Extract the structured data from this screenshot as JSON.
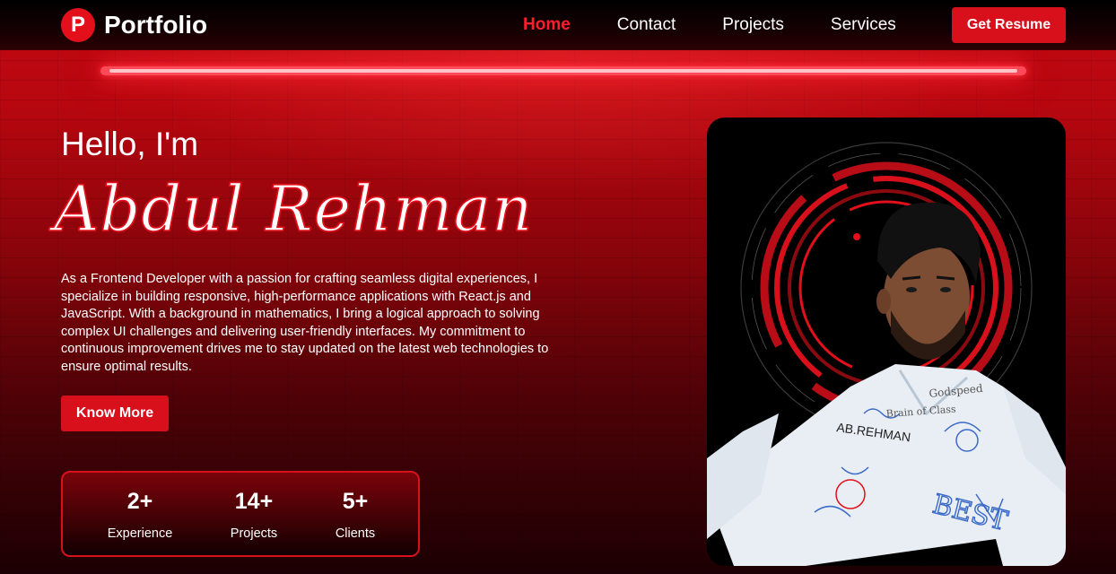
{
  "brand": {
    "logo_letter": "P",
    "name": "Portfolio"
  },
  "nav": {
    "links": [
      "Home",
      "Contact",
      "Projects",
      "Services"
    ],
    "active": "Home",
    "resume_label": "Get Resume"
  },
  "hero": {
    "greeting": "Hello, I'm",
    "name": "Abdul Rehman",
    "bio": "As a Frontend Developer with a passion for crafting seamless digital experiences, I specialize in building responsive, high-performance applications with React.js and JavaScript. With a background in mathematics, I bring a logical approach to solving complex UI challenges and delivering user-friendly interfaces. My commitment to continuous improvement drives me to stay updated on the latest web technologies to ensure optimal results.",
    "cta_label": "Know More"
  },
  "stats": [
    {
      "value": "2+",
      "label": "Experience"
    },
    {
      "value": "14+",
      "label": "Projects"
    },
    {
      "value": "5+",
      "label": "Clients"
    }
  ],
  "photo": {
    "shirt_text": [
      "AB.REHMAN",
      "Godspeed",
      "Brain of Class",
      "BEST"
    ]
  },
  "colors": {
    "accent": "#d8101b",
    "accent_active": "#ff1f2c",
    "background_top": "#c20a12",
    "background_bottom": "#1c0003"
  }
}
